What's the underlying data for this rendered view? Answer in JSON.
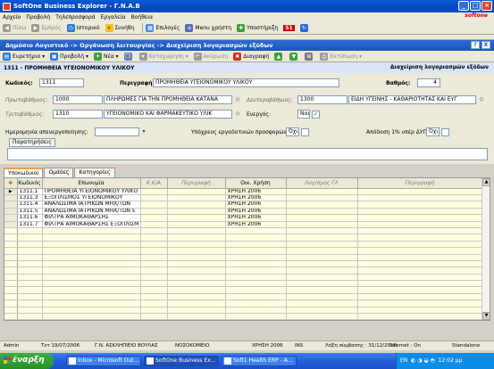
{
  "window": {
    "title": "SoftOne Business Explorer - Γ.Ν.Α.Β"
  },
  "menu": {
    "items": [
      "Αρχείο",
      "Προβολή",
      "Τηλεπροσφορά",
      "Εργαλεία",
      "Βοήθεια"
    ],
    "brand": "softone"
  },
  "toolbar": {
    "back": "Πίσω",
    "forward": "Εμπρός",
    "history": "Ιστορικό",
    "favorites": "Συνήθη",
    "options": "Επιλογές",
    "user_menu": "Menu χρήστη",
    "support": "Υποστήριξη",
    "s1": "S1"
  },
  "panel": {
    "title": "Δημόσιο Λογιστικό -> Οργάνωση λειτουργίας -> Διαχείριση λογαριασμών εξόδων",
    "help": "?",
    "close": "X"
  },
  "form_toolbar": {
    "wizard": "Ευρετήριο",
    "view": "Προβολή",
    "new": "Νέα",
    "save": "Καταχώρηση",
    "cancel": "Ακύρωση",
    "delete": "Διαγραφή",
    "print": "Εκτύπωση"
  },
  "record": {
    "header": "1311 - ΠΡΟΜΗΘΕΙΑ ΥΓΕΙΟΝΟΜΙΚΟΥ ΥΛΙΚΟΥ",
    "module": "Διαχείριση λογαριασμών εξόδων"
  },
  "fields": {
    "code_label": "Κωδικός:",
    "code": "1311",
    "desc_label": "Περιγραφή:",
    "desc": "ΠΡΟΜΗΘΕΙΑ ΥΓΕΙΟΝΟΜΙΚΟΥ ΥΛΙΚΟΥ",
    "grade_label": "Βαθμός:",
    "grade": "4",
    "primary_label": "Πρωτοβάθμιος:",
    "primary_code": "1000",
    "primary_desc": "ΠΛΗΡΩΜΕΣ ΓΙΑ ΤΗΝ ΠΡΟΜΗΘΕΙΑ ΚΑΤΑΝΑ",
    "secondary_label": "Δευτεροβάθμιος:",
    "secondary_code": "1300",
    "secondary_desc": "ΕΙΔΗ ΥΓΕΙΝΗΣ - ΚΑΘΑΡΙΟΤΗΤΑΣ ΚΑΙ ΕΥΓ",
    "tertiary_label": "Τριτοβάθμιος:",
    "tertiary_code": "1310",
    "tertiary_desc": "ΥΓΕΙΟΝΟΜΙΚΟ ΚΑΙ ΦΑΡΜΑΚΕΥΤΙΚΟ ΥΛΙΚ",
    "active_label": "Ενεργός:",
    "active_value": "Ναι",
    "deactivation_label": "Ημερομηνία απενεργοποίησης:",
    "labs_label": "Υπόχρεος εργαδοτικών προσφορών:",
    "labs_value": "Όχι",
    "dype_label": "Απόδοση 1% υπέρ ΔΥΠΕ:",
    "dype_value": "Όχι",
    "notes_button": "Παρατηρήσεις"
  },
  "tabs": [
    {
      "label": "Υποκωδικοί",
      "active": true
    },
    {
      "label": "Ομάδες",
      "active": false
    },
    {
      "label": "Κατηγορίες",
      "active": false
    }
  ],
  "grid": {
    "columns": [
      "",
      "Κωδικός",
      "Επωνυμία",
      "Κ.Κ/Α",
      "Περιγραφή",
      "Οικ. Χρήση",
      "Λογ/σμος ΓΛ",
      "Περιγραφή"
    ],
    "rows": [
      {
        "code": "1311.1",
        "name": "ΠΡΟΜΗΘΕΙΑ ΥΓΕΙΟΝΟΜΙΚΟΥ ΥΛΙΚΟ",
        "year": "ΧΡΗΣΗ 2006"
      },
      {
        "code": "1311.3",
        "name": "ΕΞΟΠΛΙΣΜΟΣ ΥΓΕΙΟΝΟΜΙΚΟΥ",
        "year": "ΧΡΗΣΗ 2006"
      },
      {
        "code": "1311.4",
        "name": "ΑΝΑΛΩΣΙΜΑ ΙΑΤΡΙΚΩΝ ΜΗΧ/ΤΩΝ",
        "year": "ΧΡΗΣΗ 2006"
      },
      {
        "code": "1311.5",
        "name": "ΑΝΑΛΩΣΙΜΑ ΙΑΤΡΙΚΩΝ ΜΗΧ/ΤΩΝ Ε",
        "year": "ΧΡΗΣΗ 2006"
      },
      {
        "code": "1311.6",
        "name": "ΦΙΛΤΡΑ ΑΙΜΟΚΑΘΑΡΣΗΣ",
        "year": "ΧΡΗΣΗ 2006"
      },
      {
        "code": "1311.7",
        "name": "ΦΙΛΤΡΑ ΑΙΜΟΚΑΘΑΡΣΗΣ ΕΞΟΠΛΙΣΜ",
        "year": "ΧΡΗΣΗ 2006"
      }
    ]
  },
  "status": {
    "user": "Admin",
    "date": "Τετ 19/07/2006",
    "company": "Γ.Ν. ΑΣΚΛΗΠΙΕΙΟ ΒΟΥΛΑΣ",
    "branch": "ΝΟΣΟΚΟΜΕΙΟ",
    "year": "ΧΡΗΣΗ 2006",
    "mode": "INS",
    "expiry": "Λήξη σύμβασης : 31/12/2010",
    "internet": "Internet : On",
    "layout": "Standalone"
  },
  "taskbar": {
    "start": "έναρξη",
    "tasks": [
      "Inbox - Microsoft Out...",
      "SoftOne Business Ex...",
      "Soft1 Health ERP - A..."
    ],
    "lang": "EN",
    "clock": "12:02 μμ"
  }
}
